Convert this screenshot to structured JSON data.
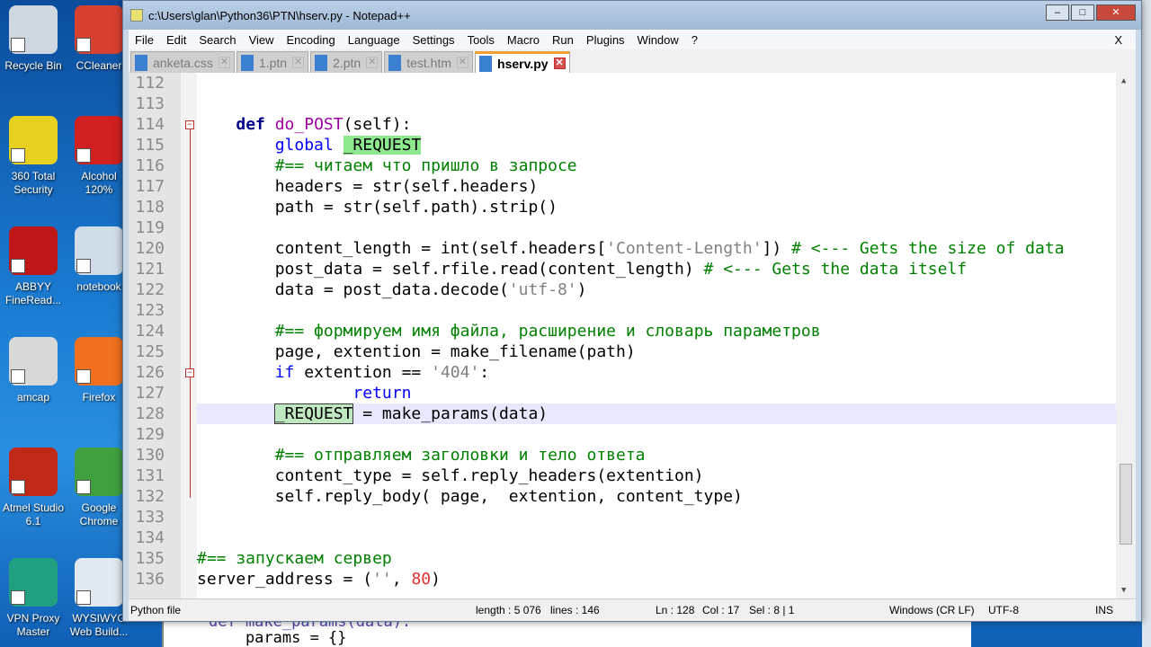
{
  "desktop": {
    "icons": [
      {
        "label": "Recycle Bin",
        "color": "#cfd8e0"
      },
      {
        "label": "CCleaner",
        "color": "#d84030"
      },
      {
        "label": "360 Total Security",
        "color": "#e8d020"
      },
      {
        "label": "Alcohol 120%",
        "color": "#d02020"
      },
      {
        "label": "ABBYY FineRead...",
        "color": "#c01818"
      },
      {
        "label": "notebook",
        "color": "#d0dce8"
      },
      {
        "label": "amcap",
        "color": "#d8d8d8"
      },
      {
        "label": "Firefox",
        "color": "#f07020"
      },
      {
        "label": "Atmel Studio 6.1",
        "color": "#c02818"
      },
      {
        "label": "Google Chrome",
        "color": "#40a040"
      },
      {
        "label": "VPN Proxy Master",
        "color": "#20a080"
      },
      {
        "label": "WYSIWYG Web Build...",
        "color": "#e0e8f0"
      }
    ]
  },
  "window": {
    "title": "c:\\Users\\glan\\Python36\\PTN\\hserv.py - Notepad++"
  },
  "menu": [
    "File",
    "Edit",
    "Search",
    "View",
    "Encoding",
    "Language",
    "Settings",
    "Tools",
    "Macro",
    "Run",
    "Plugins",
    "Window",
    "?"
  ],
  "menu_close": "X",
  "tabs": [
    {
      "label": "anketa.css"
    },
    {
      "label": "1.ptn"
    },
    {
      "label": "2.ptn"
    },
    {
      "label": "test.htm"
    },
    {
      "label": "hserv.py",
      "active": true
    }
  ],
  "code": [
    {
      "n": "112",
      "t": []
    },
    {
      "n": "113",
      "t": []
    },
    {
      "n": "114",
      "t": [
        [
          "    ",
          ""
        ],
        [
          "def",
          "kw"
        ],
        [
          " ",
          ""
        ],
        [
          "do_POST",
          "fn"
        ],
        [
          "(self):",
          ""
        ]
      ]
    },
    {
      "n": "115",
      "t": [
        [
          "        ",
          ""
        ],
        [
          "global",
          "kw2"
        ],
        [
          " ",
          ""
        ],
        [
          "_REQUEST",
          "hl"
        ]
      ]
    },
    {
      "n": "116",
      "t": [
        [
          "        ",
          ""
        ],
        [
          "#== читаем что пришло в запросе",
          "cm"
        ]
      ]
    },
    {
      "n": "117",
      "t": [
        [
          "        headers = str(self.headers)",
          ""
        ]
      ]
    },
    {
      "n": "118",
      "t": [
        [
          "        path = str(self.path).strip()",
          ""
        ]
      ]
    },
    {
      "n": "119",
      "t": []
    },
    {
      "n": "120",
      "t": [
        [
          "        content_length = int(self.headers[",
          ""
        ],
        [
          "'Content-Length'",
          "st"
        ],
        [
          "]) ",
          ""
        ],
        [
          "# <--- Gets the size of data",
          "cm"
        ]
      ]
    },
    {
      "n": "121",
      "t": [
        [
          "        post_data = self.rfile.read(content_length) ",
          ""
        ],
        [
          "# <--- Gets the data itself",
          "cm"
        ]
      ]
    },
    {
      "n": "122",
      "t": [
        [
          "        data = post_data.decode(",
          ""
        ],
        [
          "'utf-8'",
          "st"
        ],
        [
          ")",
          ""
        ]
      ]
    },
    {
      "n": "123",
      "t": []
    },
    {
      "n": "124",
      "t": [
        [
          "        ",
          ""
        ],
        [
          "#== формируем имя файла, расширение и словарь параметров",
          "cm"
        ]
      ]
    },
    {
      "n": "125",
      "t": [
        [
          "        page, extention = make_filename(path)",
          ""
        ]
      ]
    },
    {
      "n": "126",
      "t": [
        [
          "        ",
          ""
        ],
        [
          "if",
          "kw2"
        ],
        [
          " extention == ",
          ""
        ],
        [
          "'404'",
          "st"
        ],
        [
          ":",
          ""
        ]
      ]
    },
    {
      "n": "127",
      "t": [
        [
          "                ",
          ""
        ],
        [
          "return",
          "kw2"
        ]
      ]
    },
    {
      "n": "128",
      "t": [
        [
          "        ",
          ""
        ],
        [
          "_REQUEST",
          "sel"
        ],
        [
          " = make_params(data)",
          ""
        ]
      ],
      "current": true
    },
    {
      "n": "129",
      "t": []
    },
    {
      "n": "130",
      "t": [
        [
          "        ",
          ""
        ],
        [
          "#== отправляем заголовки и тело ответа",
          "cm"
        ]
      ]
    },
    {
      "n": "131",
      "t": [
        [
          "        content_type = self.reply_headers(extention)",
          ""
        ]
      ]
    },
    {
      "n": "132",
      "t": [
        [
          "        self.reply_body( page,  extention, content_type)",
          ""
        ]
      ]
    },
    {
      "n": "133",
      "t": []
    },
    {
      "n": "134",
      "t": []
    },
    {
      "n": "135",
      "t": [
        [
          "#== запускаем сервер",
          "cm"
        ]
      ]
    },
    {
      "n": "136",
      "t": [
        [
          "server_address = (",
          ""
        ],
        [
          "''",
          "st"
        ],
        [
          ", ",
          ""
        ],
        [
          "80",
          "nu"
        ],
        [
          ")",
          ""
        ]
      ]
    }
  ],
  "status": {
    "filetype": "Python file",
    "length": "length : 5 076",
    "lines": "lines : 146",
    "ln": "Ln : 128",
    "col": "Col : 17",
    "sel": "Sel : 8 | 1",
    "eol": "Windows (CR LF)",
    "encoding": "UTF-8",
    "mode": "INS"
  },
  "behind_window": {
    "lines": [
      "def make_params(data):",
      "    params = {}"
    ]
  }
}
